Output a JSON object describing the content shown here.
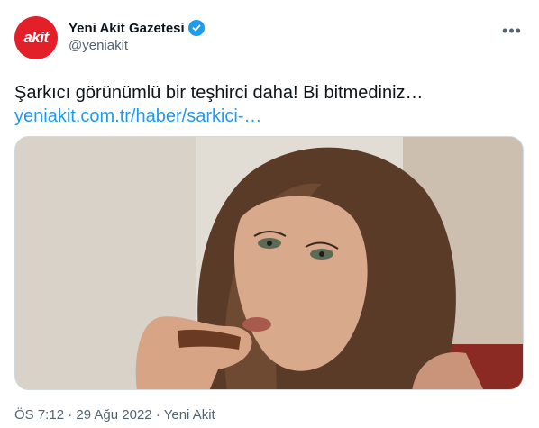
{
  "tweet": {
    "author": {
      "avatar_text": "akit",
      "display_name": "Yeni Akit Gazetesi",
      "handle": "@yeniakit",
      "verified": true,
      "avatar_color": "#e3202a"
    },
    "more_icon": "more-horizontal-icon",
    "text": "Şarkıcı görünümlü bir teşhirci daha! Bi bitmediniz…",
    "link_text": "yeniakit.com.tr/haber/sarkici-…",
    "meta": {
      "time": "ÖS 7:12",
      "separator1": " · ",
      "date": "29 Ağu 2022",
      "separator2": " · ",
      "source": "Yeni Akit"
    }
  },
  "colors": {
    "link": "#1d9bf0",
    "secondary_text": "#536471",
    "verified_badge": "#1d9bf0"
  }
}
